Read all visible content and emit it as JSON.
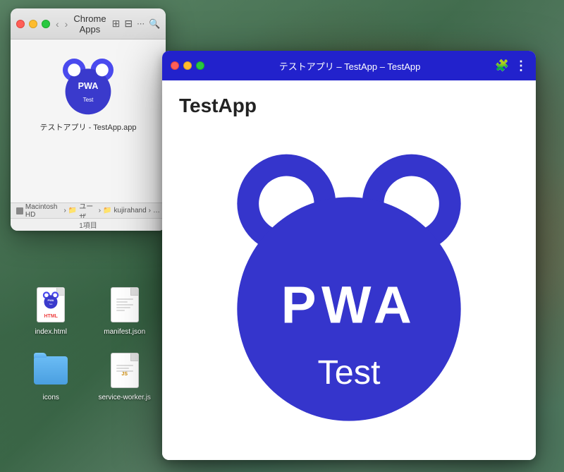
{
  "desktop": {
    "bg_color1": "#5a8a6a",
    "bg_color2": "#3a6a4a"
  },
  "finder": {
    "title": "Chrome Apps",
    "app_name": "テストアプリ - TestApp.app",
    "breadcrumb": {
      "disk": "Macintosh HD",
      "path1": "ユーザ",
      "path2": "kujirahand",
      "separator": "›"
    },
    "count": "1項目"
  },
  "chrome_window": {
    "title": "テストアプリ – TestApp – TestApp",
    "app_heading": "TestApp"
  },
  "files": [
    {
      "name": "index.html",
      "type": "html"
    },
    {
      "name": "manifest.json",
      "type": "json"
    },
    {
      "name": "icons",
      "type": "folder"
    },
    {
      "name": "service-worker.js",
      "type": "js"
    }
  ],
  "pwa": {
    "main_text": "PWA",
    "sub_text": "Test",
    "body_color": "#3a3acc",
    "ear_color": "#4a4aee",
    "eye_white": "white",
    "text_color": "white"
  },
  "icons": {
    "back_arrow": "‹",
    "forward_arrow": "›",
    "grid": "⊞",
    "search": "🔍",
    "puzzle": "🧩",
    "menu": "⋮"
  }
}
